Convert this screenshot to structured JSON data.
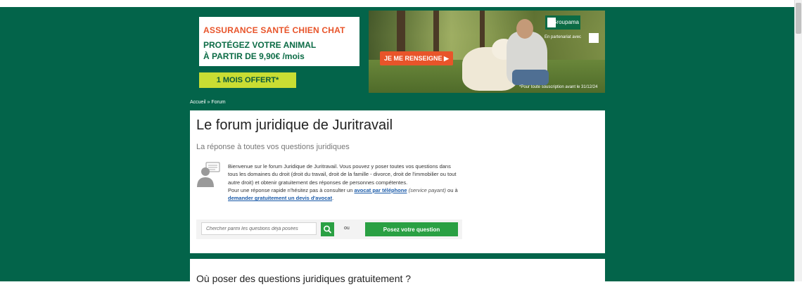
{
  "ad": {
    "title": "ASSURANCE SANTÉ CHIEN CHAT",
    "subtitle_line1": "PROTÉGEZ VOTRE ANIMAL",
    "subtitle_line2": "À PARTIR DE 9,90€ /mois",
    "offer": "1 MOIS OFFERT*",
    "cta": "JE ME RENSEIGNE ▶",
    "brand": "Groupama",
    "partner_text": "En partenariat avec",
    "fine_print": "*Pour toute souscription avant le 31/12/24"
  },
  "breadcrumb": {
    "home": "Accueil",
    "separator": " » ",
    "current": "Forum"
  },
  "main": {
    "title": "Le forum juridique de Juritravail",
    "subtitle": "La réponse à toutes vos questions juridiques",
    "intro_p1": "Bienvenue sur le forum Juridique de Juritravail. Vous pouvez y poser toutes vos questions dans tous les domaines du droit (droit du travail, droit de la famille - divorce, droit de l'immobilier ou tout autre droit) et obtenir gratuitement des réponses de personnes compétentes.",
    "intro_p2_before": "Pour une réponse rapide n'hésitez pas à consulter un ",
    "link_phone": "avocat par téléphone",
    "intro_p2_paid": "(service payant)",
    "intro_p2_mid": " ou à ",
    "link_quote": "demander gratuitement un devis d'avocat",
    "intro_p2_end": "."
  },
  "search": {
    "placeholder": "Chercher parmi les questions déjà posées",
    "or_label": "ou",
    "ask_button": "Posez votre question"
  },
  "section2": {
    "title": "Où poser des questions juridiques gratuitement ?"
  },
  "colors": {
    "background": "#03644a",
    "accent_green": "#2aa043",
    "ad_orange": "#e8542a",
    "ad_lime": "#c9dd33",
    "link_blue": "#1a5aa8"
  }
}
